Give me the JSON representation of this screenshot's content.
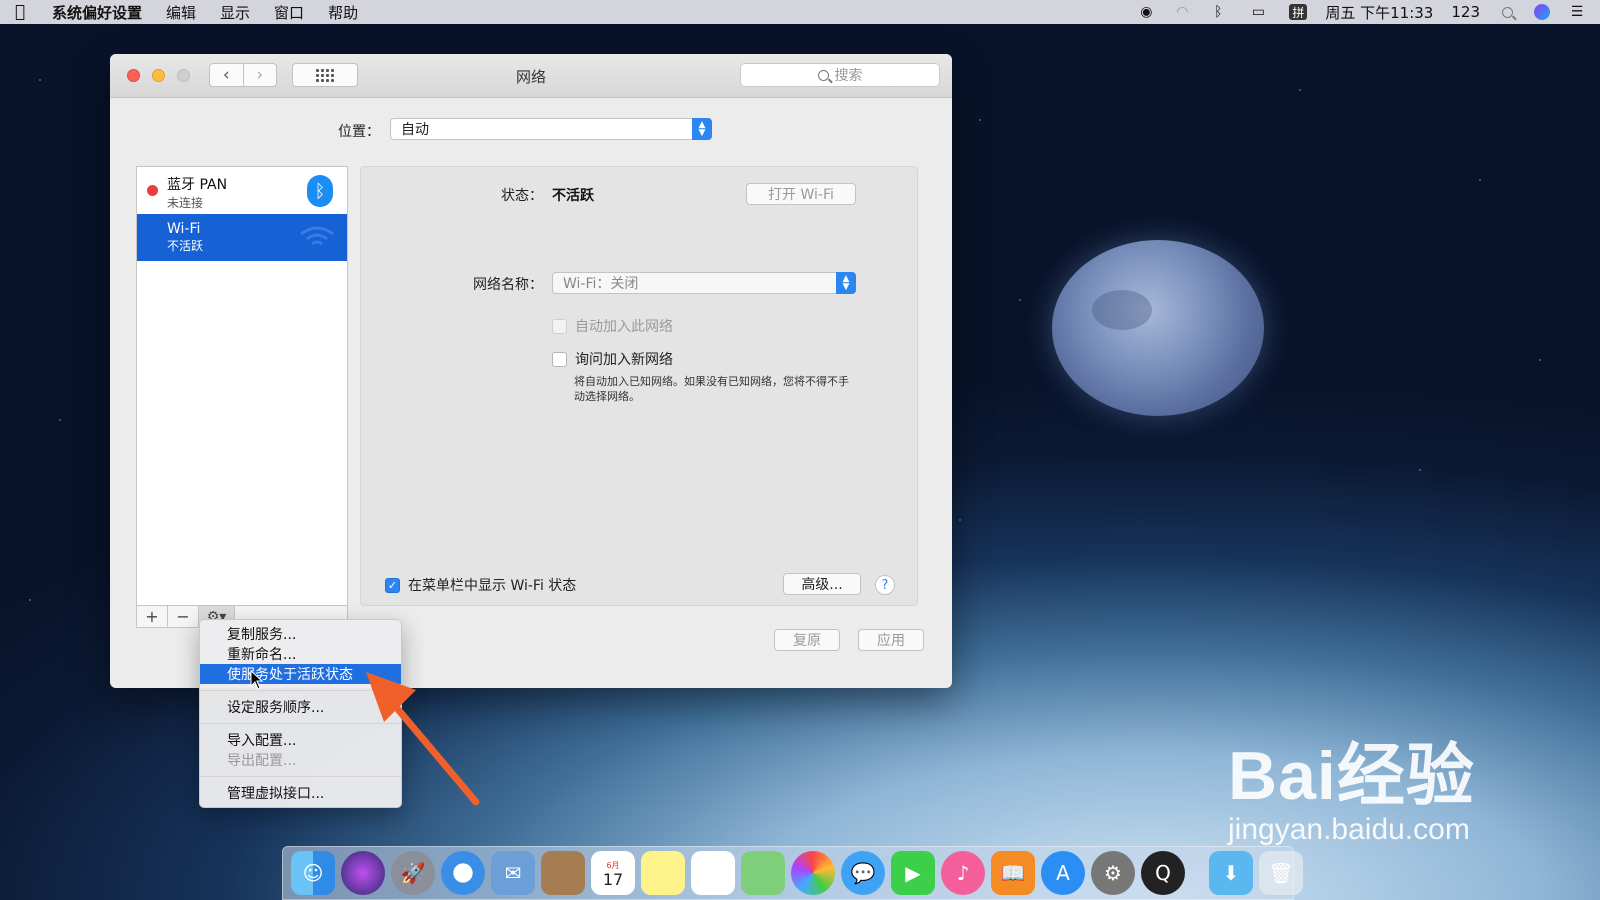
{
  "menubar": {
    "app_name": "系统偏好设置",
    "items": [
      "编辑",
      "显示",
      "窗口",
      "帮助"
    ],
    "clock": "周五 下午11:33",
    "input_method": "拼",
    "input_label": "123"
  },
  "window": {
    "title": "网络",
    "search_placeholder": "搜索",
    "location_label": "位置：",
    "location_value": "自动"
  },
  "services": [
    {
      "name": "蓝牙 PAN",
      "status": "未连接",
      "selected": false
    },
    {
      "name": "Wi-Fi",
      "status": "不活跃",
      "selected": true
    }
  ],
  "detail": {
    "status_label": "状态：",
    "status_value": "不活跃",
    "turn_on_button": "打开 Wi-Fi",
    "network_name_label": "网络名称：",
    "network_name_value": "Wi-Fi：关闭",
    "auto_join_label": "自动加入此网络",
    "ask_join_label": "询问加入新网络",
    "ask_join_note": "将自动加入已知网络。如果没有已知网络，您将不得不手动选择网络。",
    "show_status_label": "在菜单栏中显示 Wi-Fi 状态",
    "advanced_button": "高级...",
    "help_button": "?",
    "revert_button": "复原",
    "apply_button": "应用"
  },
  "context_menu": {
    "items": [
      {
        "label": "复制服务...",
        "state": "normal"
      },
      {
        "label": "重新命名...",
        "state": "normal"
      },
      {
        "label": "使服务处于活跃状态",
        "state": "highlighted"
      },
      {
        "label": "设定服务顺序...",
        "state": "normal"
      },
      {
        "label": "导入配置...",
        "state": "normal"
      },
      {
        "label": "导出配置...",
        "state": "disabled"
      },
      {
        "label": "管理虚拟接口...",
        "state": "normal"
      }
    ]
  },
  "dock": {
    "calendar_day": "17",
    "calendar_month": "6月"
  },
  "watermark": {
    "brand": "Bai经验",
    "url": "jingyan.baidu.com"
  },
  "colors": {
    "selection_blue": "#1661d6",
    "arrow_orange": "#f0602a"
  }
}
